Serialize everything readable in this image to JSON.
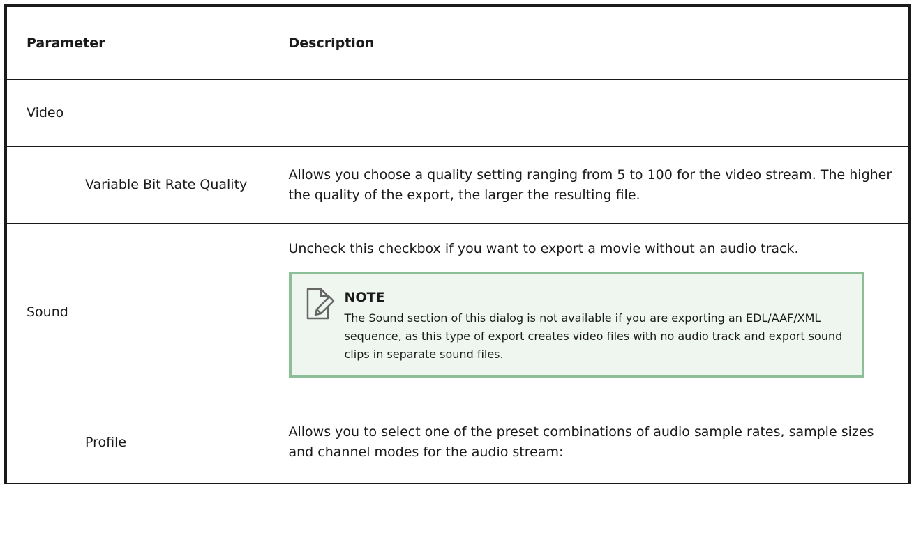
{
  "table": {
    "headers": {
      "parameter": "Parameter",
      "description": "Description"
    },
    "section_video": "Video",
    "rows": [
      {
        "parameter": "Variable Bit Rate Quality",
        "description": "Allows you choose a quality setting ranging from 5 to 100 for the video stream. The higher the quality of the export, the larger the resulting file."
      },
      {
        "parameter": "Sound",
        "description": "Uncheck this checkbox if you want to export a movie without an audio track.",
        "note": {
          "icon": "note-icon",
          "title": "NOTE",
          "text": "The Sound section of this dialog is not available if you are exporting an EDL/AAF/XML sequence, as this type of export creates video files with no audio track and export sound clips in separate sound files."
        }
      },
      {
        "parameter": "Profile",
        "description": "Allows you to select one of the preset combinations of audio sample rates, sample sizes and channel modes for the audio stream:"
      }
    ]
  },
  "colors": {
    "note_border": "#8cbf98",
    "note_background": "#eff6f0"
  }
}
